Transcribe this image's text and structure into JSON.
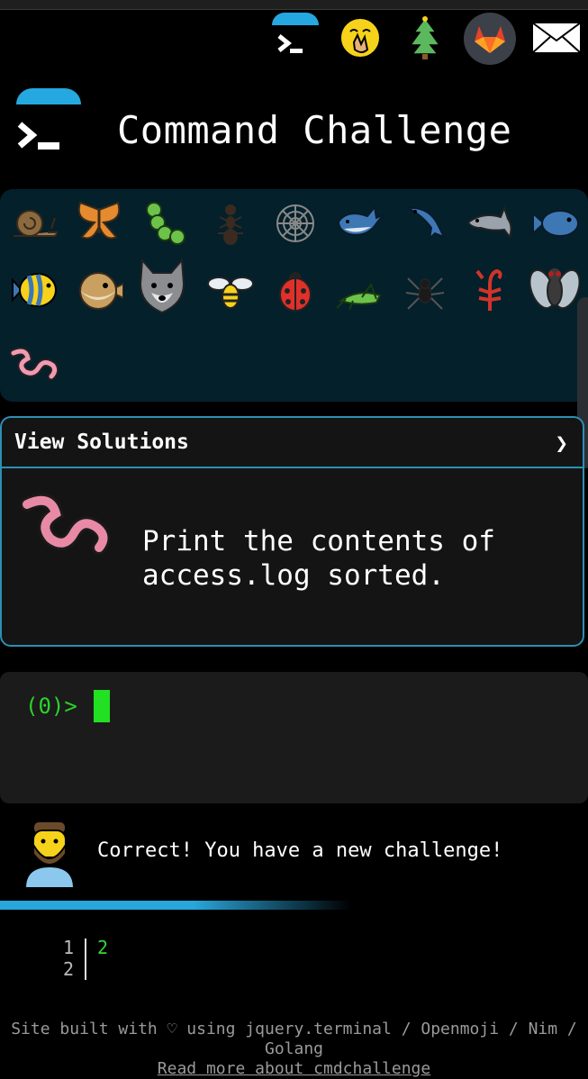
{
  "header": {
    "title": "Command Challenge"
  },
  "top_icons": [
    "terminal-icon",
    "shushing-face-icon",
    "tree-icon",
    "gitlab-icon",
    "mail-icon"
  ],
  "critters": [
    "snail",
    "butterfly",
    "caterpillar",
    "ant",
    "spider-web",
    "whale",
    "dolphin-jumping",
    "dolphin",
    "fish",
    "tropical-fish",
    "blowfish",
    "wolf",
    "bee",
    "ladybug",
    "cricket",
    "spider",
    "scorpion",
    "fly",
    "worm"
  ],
  "card": {
    "header_label": "View Solutions",
    "chevron": "❯",
    "challenge_text": "Print the contents of access.log sorted."
  },
  "terminal": {
    "prompt": "(0)>"
  },
  "message": {
    "text": "Correct! You have a new challenge!"
  },
  "output": {
    "line_numbers": [
      "1",
      "2"
    ],
    "value": "2"
  },
  "footer": {
    "line1": "Site built with ♡ using jquery.terminal / Openmoji / Nim / Golang",
    "line2": "Read more about cmdchallenge"
  },
  "colors": {
    "accent": "#25a8e0",
    "panel": "#04202b",
    "prompt_green": "#2bd32b"
  }
}
